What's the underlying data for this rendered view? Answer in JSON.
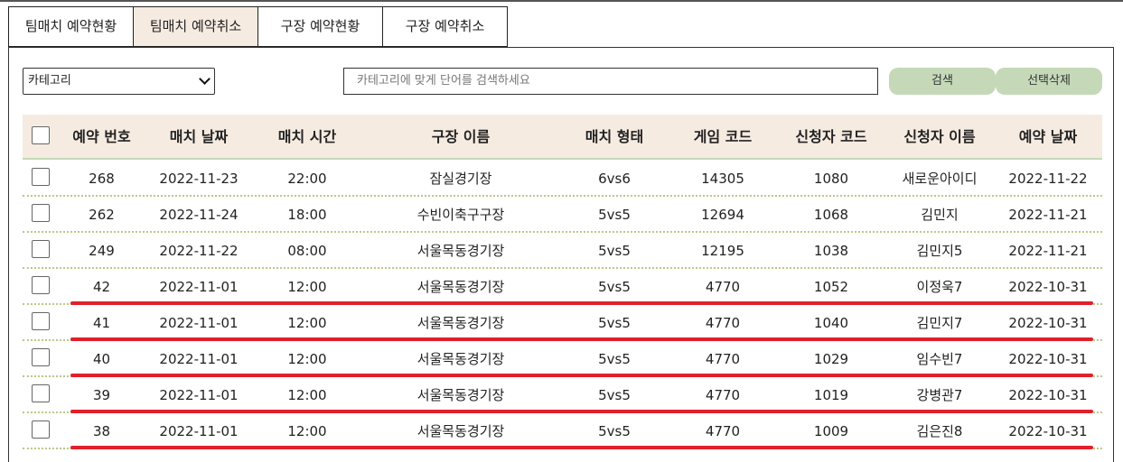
{
  "tabs": [
    {
      "label": "팀매치 예약현황",
      "active": false
    },
    {
      "label": "팀매치 예약취소",
      "active": true
    },
    {
      "label": "구장 예약현황",
      "active": false
    },
    {
      "label": "구장 예약취소",
      "active": false
    }
  ],
  "filter": {
    "category_value": "카테고리",
    "search_placeholder": "카테고리에 맞게 단어를 검색하세요",
    "search_button": "검색",
    "delete_button": "선택삭제"
  },
  "table": {
    "headers": [
      "예약 번호",
      "매치 날짜",
      "매치 시간",
      "구장 이름",
      "매치 형태",
      "게임 코드",
      "신청자 코드",
      "신청자 이름",
      "예약 날짜"
    ],
    "rows": [
      [
        "268",
        "2022-11-23",
        "22:00",
        "잠실경기장",
        "6vs6",
        "14305",
        "1080",
        "새로운아이디",
        "2022-11-22"
      ],
      [
        "262",
        "2022-11-24",
        "18:00",
        "수빈이축구구장",
        "5vs5",
        "12694",
        "1068",
        "김민지",
        "2022-11-21"
      ],
      [
        "249",
        "2022-11-22",
        "08:00",
        "서울목동경기장",
        "5vs5",
        "12195",
        "1038",
        "김민지5",
        "2022-11-21"
      ],
      [
        "42",
        "2022-11-01",
        "12:00",
        "서울목동경기장",
        "5vs5",
        "4770",
        "1052",
        "이정욱7",
        "2022-10-31"
      ],
      [
        "41",
        "2022-11-01",
        "12:00",
        "서울목동경기장",
        "5vs5",
        "4770",
        "1040",
        "김민지7",
        "2022-10-31"
      ],
      [
        "40",
        "2022-11-01",
        "12:00",
        "서울목동경기장",
        "5vs5",
        "4770",
        "1029",
        "임수빈7",
        "2022-10-31"
      ],
      [
        "39",
        "2022-11-01",
        "12:00",
        "서울목동경기장",
        "5vs5",
        "4770",
        "1019",
        "강병관7",
        "2022-10-31"
      ],
      [
        "38",
        "2022-11-01",
        "12:00",
        "서울목동경기장",
        "5vs5",
        "4770",
        "1009",
        "김은진8",
        "2022-10-31"
      ]
    ],
    "highlighted_rows": [
      "42",
      "41",
      "40",
      "39",
      "38"
    ]
  },
  "colors": {
    "header_bg": "#f6ebe1",
    "active_tab_bg": "#f6ebe1",
    "button_bg": "#c5d9b9",
    "row_divider": "#b9c98a",
    "annotation_red": "#e0202b"
  }
}
